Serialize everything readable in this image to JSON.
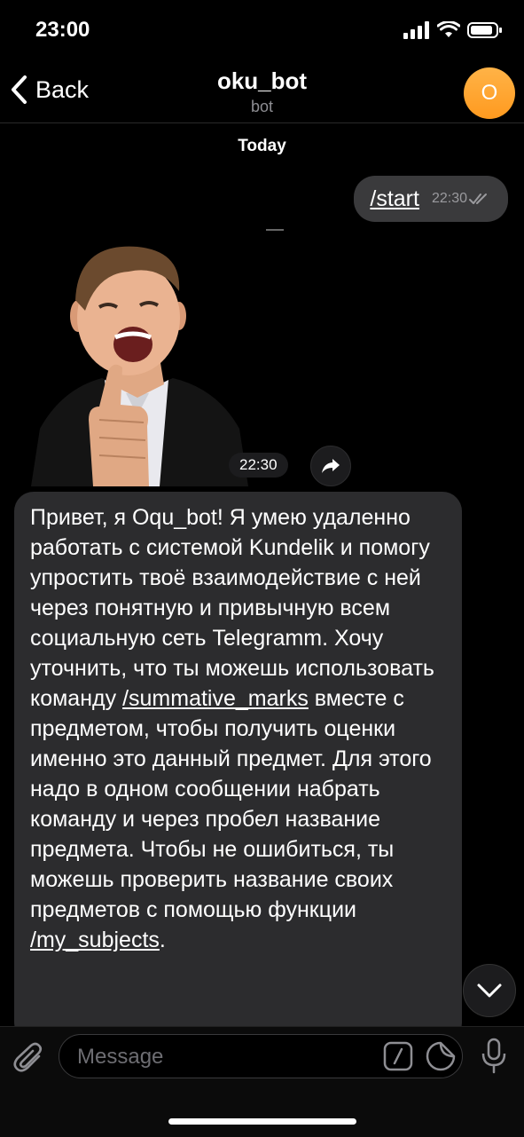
{
  "status": {
    "time": "23:00"
  },
  "nav": {
    "back_label": "Back",
    "title": "oku_bot",
    "subtitle": "bot",
    "avatar_letter": "O"
  },
  "chat": {
    "date_label": "Today",
    "outgoing": {
      "text": "/start",
      "time": "22:30"
    },
    "sticker": {
      "time": "22:30"
    },
    "incoming": {
      "part1": "Привет, я Oqu_bot! Я умею удаленно работать с системой Kundelik и помогу упростить твоё взаимодействие с ней через понятную и привычную всем социальную сеть Telegramm. Хочу уточнить, что ты можешь использовать команду ",
      "cmd1": "/summative_marks",
      "part2": " вместе с предметом, чтобы получить оценки именно это данный предмет. Для этого надо в одном сообщении набрать команду и через пробел название предмета. Чтобы не ошибиться, ты можешь проверить название своих предметов с помощью функции ",
      "cmd2": "/my_subjects",
      "part3": "."
    }
  },
  "input": {
    "placeholder": "Message"
  },
  "colors": {
    "background": "#000000",
    "bubble": "#2c2c2e",
    "avatar": "#ff9a1f"
  }
}
